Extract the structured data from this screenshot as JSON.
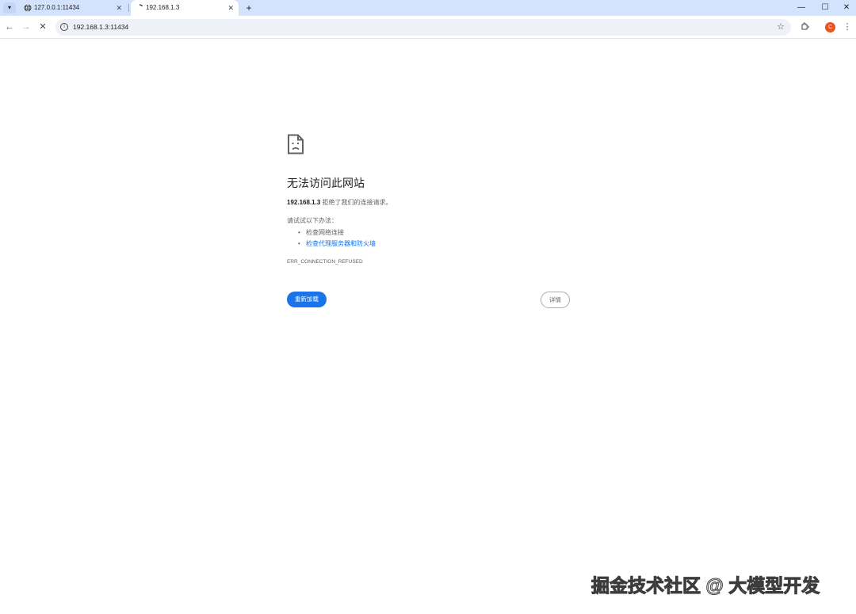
{
  "browser": {
    "tab_menu_icon": "chevron-down-icon",
    "tabs": [
      {
        "title": "127.0.0.1:11434",
        "favicon": "globe-icon",
        "active": false
      },
      {
        "title": "192.168.1.3",
        "favicon": "loading-spinner-icon",
        "active": true
      }
    ],
    "tab_close_glyph": "✕",
    "new_tab_glyph": "+",
    "window_controls": {
      "minimize": "—",
      "maximize": "☐",
      "close": "✕"
    },
    "nav": {
      "back": "←",
      "forward": "→",
      "stop": "✕"
    },
    "url": "192.168.1.3:11434",
    "profile_initial": "C",
    "accent": "#d3e3fd"
  },
  "error_page": {
    "heading": "无法访问此网站",
    "host": "192.168.1.3",
    "message": "拒绝了我们的连接请求。",
    "try_label": "请试试以下办法：",
    "suggestions": [
      "检查网络连接",
      "检查代理服务器和防火墙"
    ],
    "error_code": "ERR_CONNECTION_REFUSED",
    "reload_label": "重新加载",
    "details_label": "详情",
    "primary_color": "#1a73e8"
  },
  "watermark": "掘金技术社区 @ 大模型开发"
}
